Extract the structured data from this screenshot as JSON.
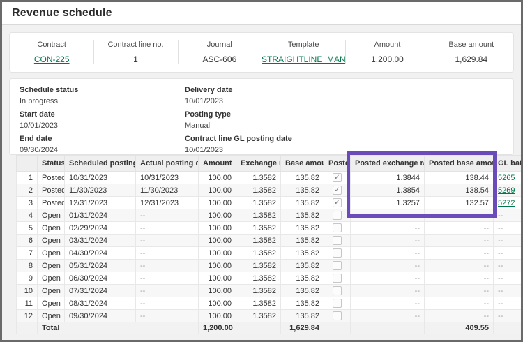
{
  "page": {
    "title": "Revenue schedule"
  },
  "colors": {
    "accent_green": "#00784b",
    "highlight_purple": "#6b4aba"
  },
  "summary": {
    "fields": [
      {
        "label": "Contract",
        "value": "CON-225",
        "link": true
      },
      {
        "label": "Contract line no.",
        "value": "1",
        "link": false
      },
      {
        "label": "Journal",
        "value": "ASC-606",
        "link": false
      },
      {
        "label": "Template",
        "value": "STRAIGHTLINE_MANUA",
        "link": true
      },
      {
        "label": "Amount",
        "value": "1,200.00",
        "link": false
      },
      {
        "label": "Base amount",
        "value": "1,629.84",
        "link": false
      }
    ]
  },
  "details": {
    "left": [
      {
        "label": "Schedule status",
        "value": "In progress"
      },
      {
        "label": "Start date",
        "value": "10/01/2023"
      },
      {
        "label": "End date",
        "value": "09/30/2024"
      }
    ],
    "right": [
      {
        "label": "Delivery date",
        "value": "10/01/2023"
      },
      {
        "label": "Posting type",
        "value": "Manual"
      },
      {
        "label": "Contract line GL posting date",
        "value": "10/01/2023"
      }
    ]
  },
  "table": {
    "columns": [
      {
        "key": "num",
        "label": "",
        "align": "right",
        "width": 30,
        "type": "text"
      },
      {
        "key": "status",
        "label": "Status",
        "align": "left",
        "width": 39,
        "type": "text"
      },
      {
        "key": "scheduled_posting_date",
        "label": "Scheduled posting date",
        "align": "left",
        "width": 102,
        "type": "text"
      },
      {
        "key": "actual_posting_date",
        "label": "Actual posting date",
        "align": "left",
        "width": 90,
        "type": "text"
      },
      {
        "key": "amount",
        "label": "Amount",
        "align": "right",
        "width": 54,
        "type": "text"
      },
      {
        "key": "exchange_rate",
        "label": "Exchange rate",
        "align": "right",
        "width": 64,
        "type": "text"
      },
      {
        "key": "base_amount",
        "label": "Base amount",
        "align": "right",
        "width": 62,
        "type": "text"
      },
      {
        "key": "posted",
        "label": "Posted",
        "align": "center",
        "width": 38,
        "type": "checkbox"
      },
      {
        "key": "posted_exchange_rate",
        "label": "Posted exchange rate",
        "align": "right",
        "width": 106,
        "type": "text"
      },
      {
        "key": "posted_base_amount",
        "label": "Posted base amount",
        "align": "right",
        "width": 99,
        "type": "text"
      },
      {
        "key": "gl_batch",
        "label": "GL batch",
        "align": "left",
        "width": 42,
        "type": "link"
      }
    ],
    "rows": [
      {
        "num": "1",
        "status": "Posted",
        "scheduled_posting_date": "10/31/2023",
        "actual_posting_date": "10/31/2023",
        "amount": "100.00",
        "exchange_rate": "1.3582",
        "base_amount": "135.82",
        "posted": true,
        "posted_exchange_rate": "1.3844",
        "posted_base_amount": "138.44",
        "gl_batch": "5265"
      },
      {
        "num": "2",
        "status": "Posted",
        "scheduled_posting_date": "11/30/2023",
        "actual_posting_date": "11/30/2023",
        "amount": "100.00",
        "exchange_rate": "1.3582",
        "base_amount": "135.82",
        "posted": true,
        "posted_exchange_rate": "1.3854",
        "posted_base_amount": "138.54",
        "gl_batch": "5269"
      },
      {
        "num": "3",
        "status": "Posted",
        "scheduled_posting_date": "12/31/2023",
        "actual_posting_date": "12/31/2023",
        "amount": "100.00",
        "exchange_rate": "1.3582",
        "base_amount": "135.82",
        "posted": true,
        "posted_exchange_rate": "1.3257",
        "posted_base_amount": "132.57",
        "gl_batch": "5272"
      },
      {
        "num": "4",
        "status": "Open",
        "scheduled_posting_date": "01/31/2024",
        "actual_posting_date": "--",
        "amount": "100.00",
        "exchange_rate": "1.3582",
        "base_amount": "135.82",
        "posted": false,
        "posted_exchange_rate": "--",
        "posted_base_amount": "--",
        "gl_batch": "--"
      },
      {
        "num": "5",
        "status": "Open",
        "scheduled_posting_date": "02/29/2024",
        "actual_posting_date": "--",
        "amount": "100.00",
        "exchange_rate": "1.3582",
        "base_amount": "135.82",
        "posted": false,
        "posted_exchange_rate": "--",
        "posted_base_amount": "--",
        "gl_batch": "--"
      },
      {
        "num": "6",
        "status": "Open",
        "scheduled_posting_date": "03/31/2024",
        "actual_posting_date": "--",
        "amount": "100.00",
        "exchange_rate": "1.3582",
        "base_amount": "135.82",
        "posted": false,
        "posted_exchange_rate": "--",
        "posted_base_amount": "--",
        "gl_batch": "--"
      },
      {
        "num": "7",
        "status": "Open",
        "scheduled_posting_date": "04/30/2024",
        "actual_posting_date": "--",
        "amount": "100.00",
        "exchange_rate": "1.3582",
        "base_amount": "135.82",
        "posted": false,
        "posted_exchange_rate": "--",
        "posted_base_amount": "--",
        "gl_batch": "--"
      },
      {
        "num": "8",
        "status": "Open",
        "scheduled_posting_date": "05/31/2024",
        "actual_posting_date": "--",
        "amount": "100.00",
        "exchange_rate": "1.3582",
        "base_amount": "135.82",
        "posted": false,
        "posted_exchange_rate": "--",
        "posted_base_amount": "--",
        "gl_batch": "--"
      },
      {
        "num": "9",
        "status": "Open",
        "scheduled_posting_date": "06/30/2024",
        "actual_posting_date": "--",
        "amount": "100.00",
        "exchange_rate": "1.3582",
        "base_amount": "135.82",
        "posted": false,
        "posted_exchange_rate": "--",
        "posted_base_amount": "--",
        "gl_batch": "--"
      },
      {
        "num": "10",
        "status": "Open",
        "scheduled_posting_date": "07/31/2024",
        "actual_posting_date": "--",
        "amount": "100.00",
        "exchange_rate": "1.3582",
        "base_amount": "135.82",
        "posted": false,
        "posted_exchange_rate": "--",
        "posted_base_amount": "--",
        "gl_batch": "--"
      },
      {
        "num": "11",
        "status": "Open",
        "scheduled_posting_date": "08/31/2024",
        "actual_posting_date": "--",
        "amount": "100.00",
        "exchange_rate": "1.3582",
        "base_amount": "135.82",
        "posted": false,
        "posted_exchange_rate": "--",
        "posted_base_amount": "--",
        "gl_batch": "--"
      },
      {
        "num": "12",
        "status": "Open",
        "scheduled_posting_date": "09/30/2024",
        "actual_posting_date": "--",
        "amount": "100.00",
        "exchange_rate": "1.3582",
        "base_amount": "135.82",
        "posted": false,
        "posted_exchange_rate": "--",
        "posted_base_amount": "--",
        "gl_batch": "--"
      }
    ],
    "total": {
      "label": "Total",
      "amount": "1,200.00",
      "base_amount": "1,629.84",
      "posted_base_amount": "409.55"
    },
    "checkmark_glyph": "✓"
  },
  "annotation": {
    "type": "highlight-box",
    "color": "#6b4aba",
    "covers": "Posted exchange rate and Posted base amount columns, header plus first 3 rows"
  }
}
